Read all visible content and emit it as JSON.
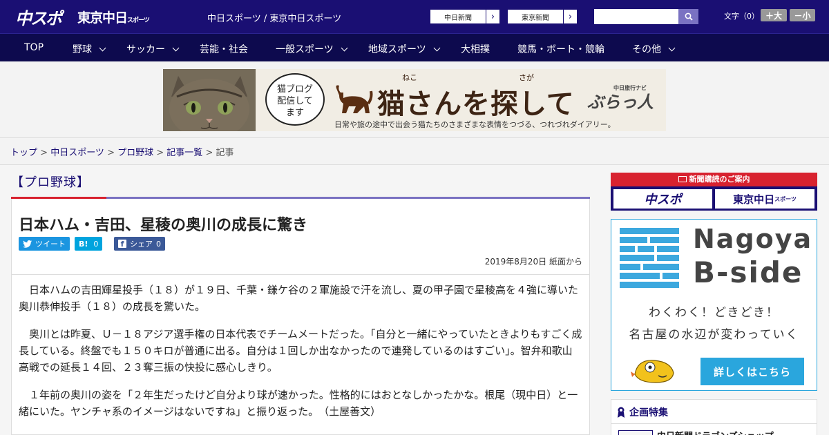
{
  "header": {
    "logo_chuspo": "中スポ",
    "logo_tokyo": "東京中日",
    "logo_tokyo_small": "スポーツ",
    "site_title": "中日スポーツ / 東京中日スポーツ",
    "paper_links": [
      {
        "label": "中日新聞",
        "arrow": "›"
      },
      {
        "label": "東京新聞",
        "arrow": "›"
      }
    ],
    "search_placeholder": "",
    "font_size_label": "文字（0）",
    "font_bigger": "＋大",
    "font_smaller": "－小"
  },
  "nav": {
    "items": [
      {
        "label": "TOP",
        "has_menu": false
      },
      {
        "label": "野球",
        "has_menu": true
      },
      {
        "label": "サッカー",
        "has_menu": true
      },
      {
        "label": "芸能・社会",
        "has_menu": false
      },
      {
        "label": "一般スポーツ",
        "has_menu": true
      },
      {
        "label": "地域スポーツ",
        "has_menu": true
      },
      {
        "label": "大相撲",
        "has_menu": false
      },
      {
        "label": "競馬・ボート・競輪",
        "has_menu": false
      },
      {
        "label": "その他",
        "has_menu": true
      }
    ]
  },
  "banner": {
    "bubble_text": "猫ブログ配信してます",
    "title": "猫さんを探して",
    "ruby_neko": "ねこ",
    "ruby_saga": "さが",
    "subtitle": "日常や旅の途中で出会う猫たちのさまざまな表情をつづる、つれづれダイアリー。",
    "brand": "ぶらっ人",
    "brand_small": "中日旅行ナビ"
  },
  "breadcrumb": {
    "items": [
      "トップ",
      "中日スポーツ",
      "プロ野球",
      "記事一覧"
    ],
    "current": "記事",
    "sep": " > "
  },
  "article": {
    "category": "【プロ野球】",
    "title": "日本ハム・吉田、星稜の奥川の成長に驚き",
    "tweet_label": "ツイート",
    "hatena_label": "B!",
    "hatena_count": "0",
    "facebook_label": "シェア",
    "facebook_count": "0",
    "date": "2019年8月20日 紙面から",
    "paragraphs": [
      "日本ハムの吉田輝星投手（１８）が１９日、千葉・鎌ケ谷の２軍施設で汗を流し、夏の甲子園で星稜高を４強に導いた奥川恭伸投手（１８）の成長を驚いた。",
      "奥川とは昨夏、Ｕ－１８アジア選手権の日本代表でチームメートだった。「自分と一緒にやっていたときよりもすごく成長している。終盤でも１５０キロが普通に出る。自分は１回しか出なかったので連発しているのはすごい」。智弁和歌山高戦での延長１４回、２３奪三振の快投に感心しきり。",
      "１年前の奥川の姿を「２年生だったけど自分より球が速かった。性格的にはおとなしかったかな。根尾（現中日）と一緒にいた。ヤンチャ系のイメージはないですね」と振り返った。　（土屋善文）"
    ]
  },
  "sidebar": {
    "subscribe_head": "新聞購読のご案内",
    "subscribe_chuspo": "中スポ",
    "subscribe_tokyo": "東京中日",
    "subscribe_tokyo_small": "スポーツ",
    "bside_title1": "Nagoya",
    "bside_title2": "B-side",
    "bside_copy1": "わくわく！どきどき！",
    "bside_copy2": "名古屋の水辺が変わっていく",
    "bside_more": "詳しくはこちら",
    "feature_head": "企画特集",
    "feature_item": "中日新聞ドラゴンズショップ"
  },
  "colors": {
    "header_bg": "#1a0f73",
    "nav_bg": "#0d0a4e",
    "accent_red": "#d8222f",
    "accent_blue": "#2aa6dd",
    "twitter": "#1b95e0",
    "hatena": "#00a4de",
    "facebook": "#3b5998"
  }
}
